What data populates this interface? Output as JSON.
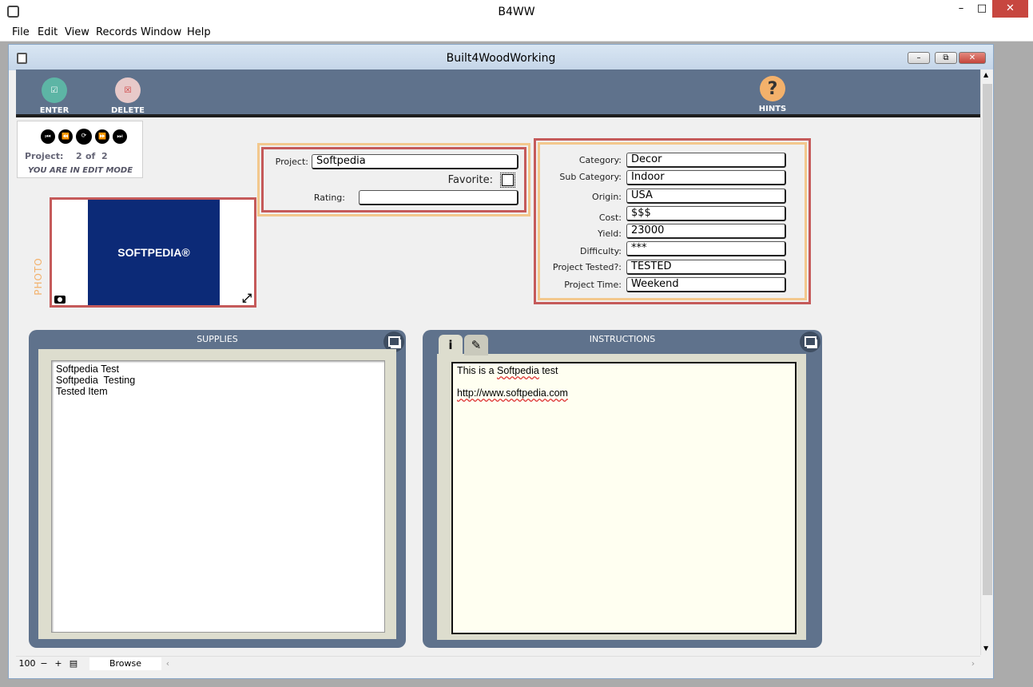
{
  "window": {
    "title": "B4WW"
  },
  "menu": [
    "File",
    "Edit",
    "View",
    "Records",
    "Window",
    "Help"
  ],
  "inner_window": {
    "title": "Built4WoodWorking"
  },
  "toolbar": {
    "enter_label": "ENTER",
    "delete_label": "DELETE",
    "hints_label": "HINTS"
  },
  "nav": {
    "project_label": "Project:",
    "current": "2",
    "of_label": "of",
    "total": "2",
    "mode": "YOU ARE IN EDIT MODE"
  },
  "photo": {
    "label": "PHOTO",
    "logo_text": "SOFTPEDIA®"
  },
  "project": {
    "project_label": "Project:",
    "project_value": "Softpedia",
    "favorite_label": "Favorite:",
    "rating_label": "Rating:",
    "rating_value": ""
  },
  "details": [
    {
      "label": "Category:",
      "value": "Decor"
    },
    {
      "label": "Sub Category:",
      "value": "Indoor"
    },
    {
      "label": "Origin:",
      "value": "USA"
    },
    {
      "label": "Cost:",
      "value": "$$$"
    },
    {
      "label": "Yield:",
      "value": "23000"
    },
    {
      "label": "Difficulty:",
      "value": "***"
    },
    {
      "label": "Project Tested?:",
      "value": "TESTED"
    },
    {
      "label": "Project Time:",
      "value": "Weekend"
    }
  ],
  "supplies": {
    "title": "SUPPLIES",
    "lines": [
      "Softpedia Test",
      "Softpedia  Testing",
      "Tested Item"
    ]
  },
  "instructions": {
    "title": "INSTRUCTIONS",
    "line1_a": "This is a ",
    "line1_b": "Softpedia",
    "line1_c": " test",
    "link": "http://www.softpedia.com"
  },
  "status": {
    "zoom": "100",
    "mode": "Browse"
  }
}
